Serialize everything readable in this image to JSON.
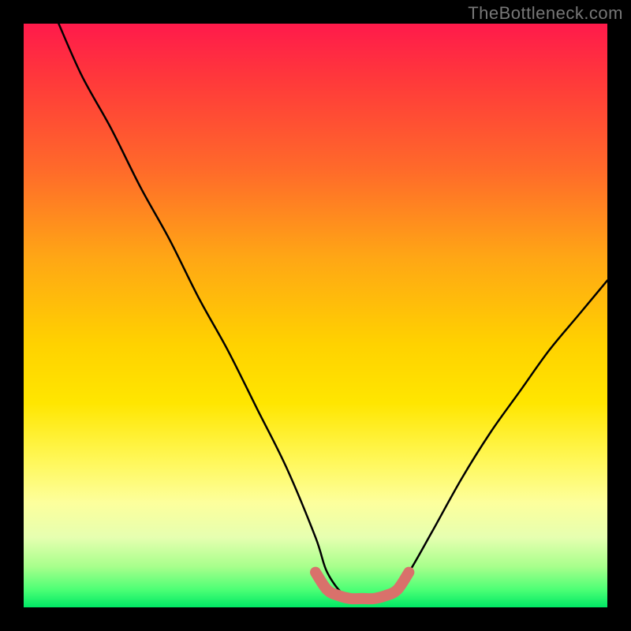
{
  "watermark": "TheBottleneck.com",
  "chart_data": {
    "type": "line",
    "title": "",
    "xlabel": "",
    "ylabel": "",
    "xlim": [
      0,
      100
    ],
    "ylim": [
      0,
      100
    ],
    "series": [
      {
        "name": "bottleneck-curve",
        "x": [
          6,
          10,
          15,
          20,
          25,
          30,
          35,
          40,
          45,
          50,
          52,
          55,
          58,
          60,
          63,
          66,
          70,
          75,
          80,
          85,
          90,
          95,
          100
        ],
        "y": [
          100,
          91,
          82,
          72,
          63,
          53,
          44,
          34,
          24,
          12,
          6,
          2,
          1,
          1,
          2,
          6,
          13,
          22,
          30,
          37,
          44,
          50,
          56
        ]
      },
      {
        "name": "marker-band",
        "x": [
          50,
          52,
          54,
          56,
          58,
          60,
          62,
          64,
          66
        ],
        "y": [
          6,
          3,
          2,
          1.5,
          1.5,
          1.5,
          2,
          3,
          6
        ]
      }
    ],
    "gradient_stops": [
      {
        "pos": 0,
        "color": "#ff1a4b"
      },
      {
        "pos": 10,
        "color": "#ff3a3a"
      },
      {
        "pos": 25,
        "color": "#ff6a2a"
      },
      {
        "pos": 40,
        "color": "#ffa615"
      },
      {
        "pos": 55,
        "color": "#ffd200"
      },
      {
        "pos": 65,
        "color": "#ffe600"
      },
      {
        "pos": 75,
        "color": "#fff85a"
      },
      {
        "pos": 82,
        "color": "#fdff9c"
      },
      {
        "pos": 88,
        "color": "#e6ffb0"
      },
      {
        "pos": 93,
        "color": "#a8ff8c"
      },
      {
        "pos": 97,
        "color": "#4cff75"
      },
      {
        "pos": 100,
        "color": "#00e865"
      }
    ],
    "curve_color": "#000000",
    "marker_color": "#d9716b"
  }
}
